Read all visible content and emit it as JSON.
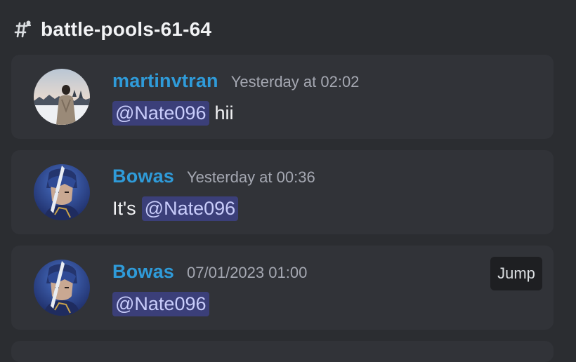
{
  "channel": {
    "name": "battle-pools-61-64",
    "icon": "hashtag-thread-icon"
  },
  "results": [
    {
      "username": "martinvtran",
      "timestamp": "Yesterday at 02:02",
      "mention": "@Nate096",
      "text_before": "",
      "text_after": "hii",
      "avatar": "avatar-martinvtran"
    },
    {
      "username": "Bowas",
      "timestamp": "Yesterday at 00:36",
      "mention": "@Nate096",
      "text_before": "It's",
      "text_after": "",
      "avatar": "avatar-bowas"
    },
    {
      "username": "Bowas",
      "timestamp": "07/01/2023 01:00",
      "mention": "@Nate096",
      "text_before": "",
      "text_after": "",
      "avatar": "avatar-bowas",
      "jump_label": "Jump"
    }
  ],
  "colors": {
    "background": "#2b2d31",
    "card": "#313338",
    "username": "#2f9bd9",
    "timestamp": "#a5a8b2",
    "mention_bg": "#3b3f79",
    "mention_text": "#c9cdfb",
    "jump_bg": "#1e1f22"
  }
}
